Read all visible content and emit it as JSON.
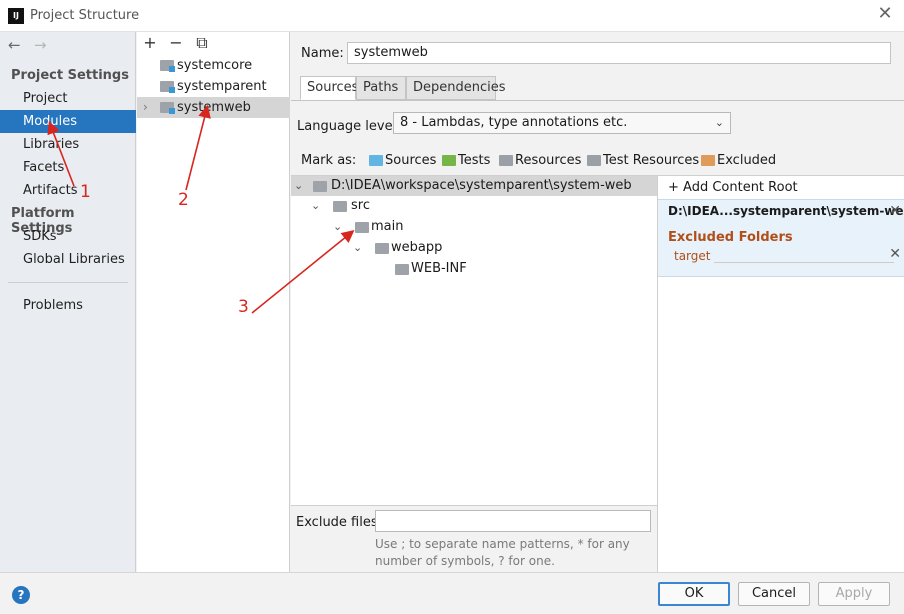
{
  "window": {
    "app_icon_text": "IJ",
    "title": "Project Structure",
    "close_label": "✕"
  },
  "nav": {
    "back": "←",
    "forward": "→"
  },
  "sidebar": {
    "project_settings_title": "Project Settings",
    "project_items": [
      {
        "label": "Project"
      },
      {
        "label": "Modules",
        "selected": true
      },
      {
        "label": "Libraries"
      },
      {
        "label": "Facets"
      },
      {
        "label": "Artifacts"
      }
    ],
    "platform_settings_title": "Platform Settings",
    "platform_items": [
      {
        "label": "SDKs"
      },
      {
        "label": "Global Libraries"
      }
    ],
    "problems_label": "Problems"
  },
  "modules": {
    "toolbar": {
      "add": "+",
      "remove": "−",
      "copy": "⧉"
    },
    "items": [
      {
        "label": "systemcore"
      },
      {
        "label": "systemparent"
      },
      {
        "label": "systemweb",
        "selected": true
      }
    ]
  },
  "module_detail": {
    "name_label": "Name:",
    "name_value": "systemweb",
    "tabs": [
      "Sources",
      "Paths",
      "Dependencies"
    ],
    "active_tab": "Sources",
    "language_level_label": "Language level:",
    "language_level_value": "8 - Lambdas, type annotations etc.",
    "mark_as_label": "Mark as:",
    "mark_as": [
      {
        "label": "Sources",
        "color": "#62b4e3"
      },
      {
        "label": "Tests",
        "color": "#78b548"
      },
      {
        "label": "Resources",
        "color": "#9aa0a6"
      },
      {
        "label": "Test Resources",
        "color": "#9aa0a6"
      },
      {
        "label": "Excluded",
        "color": "#e09a5a"
      }
    ],
    "tree": {
      "root": "D:\\IDEA\\workspace\\systemparent\\system-web",
      "src": "src",
      "main": "main",
      "webapp": "webapp",
      "webinf": "WEB-INF"
    },
    "exclude_files_label": "Exclude files:",
    "exclude_files_value": "",
    "exclude_hint": "Use ; to separate name patterns, * for any number of symbols, ? for one."
  },
  "content_roots": {
    "add_label": "Add Content Root",
    "root_path": "D:\\IDEA...systemparent\\system-web",
    "excluded_title": "Excluded Folders",
    "excluded_items": [
      "target"
    ]
  },
  "buttons": {
    "help": "?",
    "ok": "OK",
    "cancel": "Cancel",
    "apply": "Apply"
  },
  "annotations": {
    "one": "1",
    "two": "2",
    "three": "3",
    "color": "#d8261e"
  }
}
